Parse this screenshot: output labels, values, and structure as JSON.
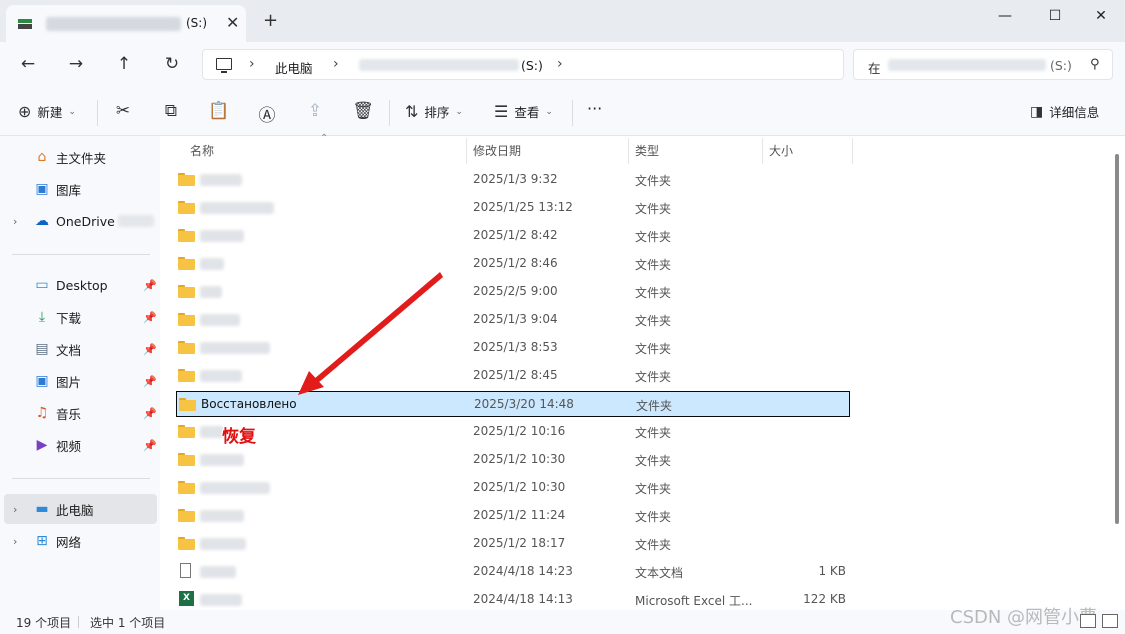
{
  "window": {
    "tab_drive": "(S:)",
    "tab_close": "✕",
    "new_tab": "+",
    "minimize": "—",
    "maximize": "☐",
    "close": "✕"
  },
  "nav": {
    "back": "←",
    "forward": "→",
    "up": "↑",
    "refresh": "↻",
    "breadcrumb_pc": "此电脑",
    "breadcrumb_drive": "(S:)",
    "search_prefix": "在",
    "search_drive": "(S:)",
    "search_icon": "⚲"
  },
  "toolbar": {
    "new_label": "新建",
    "sort_label": "排序",
    "view_label": "查看",
    "more_label": "···",
    "details_label": "详细信息"
  },
  "sidebar": {
    "top_items": [
      {
        "label": "主文件夹",
        "icon": "home-icon"
      },
      {
        "label": "图库",
        "icon": "gallery-icon"
      },
      {
        "label": "OneDrive",
        "icon": "cloud-icon"
      }
    ],
    "pinned_items": [
      {
        "label": "Desktop",
        "icon": "desktop-icon"
      },
      {
        "label": "下载",
        "icon": "download-icon"
      },
      {
        "label": "文档",
        "icon": "document-icon"
      },
      {
        "label": "图片",
        "icon": "pictures-icon"
      },
      {
        "label": "音乐",
        "icon": "music-icon"
      },
      {
        "label": "视频",
        "icon": "video-icon"
      }
    ],
    "bottom_items": [
      {
        "label": "此电脑",
        "icon": "pc-icon"
      },
      {
        "label": "网络",
        "icon": "network-icon"
      }
    ]
  },
  "columns": {
    "name": "名称",
    "date": "修改日期",
    "type": "类型",
    "size": "大小"
  },
  "files": [
    {
      "name": "",
      "date": "2025/1/3 9:32",
      "type": "文件夹",
      "size": "",
      "kind": "folder"
    },
    {
      "name": "",
      "date": "2025/1/25 13:12",
      "type": "文件夹",
      "size": "",
      "kind": "folder"
    },
    {
      "name": "",
      "date": "2025/1/2 8:42",
      "type": "文件夹",
      "size": "",
      "kind": "folder"
    },
    {
      "name": "",
      "date": "2025/1/2 8:46",
      "type": "文件夹",
      "size": "",
      "kind": "folder"
    },
    {
      "name": "",
      "date": "2025/2/5 9:00",
      "type": "文件夹",
      "size": "",
      "kind": "folder"
    },
    {
      "name": "",
      "date": "2025/1/3 9:04",
      "type": "文件夹",
      "size": "",
      "kind": "folder"
    },
    {
      "name": "",
      "date": "2025/1/3 8:53",
      "type": "文件夹",
      "size": "",
      "kind": "folder"
    },
    {
      "name": "",
      "date": "2025/1/2 8:45",
      "type": "文件夹",
      "size": "",
      "kind": "folder"
    },
    {
      "name": "Восстановлено",
      "date": "2025/3/20 14:48",
      "type": "文件夹",
      "size": "",
      "kind": "folder",
      "selected": true
    },
    {
      "name": "",
      "date": "2025/1/2 10:16",
      "type": "文件夹",
      "size": "",
      "kind": "folder"
    },
    {
      "name": "",
      "date": "2025/1/2 10:30",
      "type": "文件夹",
      "size": "",
      "kind": "folder"
    },
    {
      "name": "",
      "date": "2025/1/2 10:30",
      "type": "文件夹",
      "size": "",
      "kind": "folder"
    },
    {
      "name": "",
      "date": "2025/1/2 11:24",
      "type": "文件夹",
      "size": "",
      "kind": "folder"
    },
    {
      "name": "",
      "date": "2025/1/2 18:17",
      "type": "文件夹",
      "size": "",
      "kind": "folder"
    },
    {
      "name": "",
      "date": "2024/4/18 14:23",
      "type": "文本文档",
      "size": "1 KB",
      "kind": "text"
    },
    {
      "name": "",
      "date": "2024/4/18 14:13",
      "type": "Microsoft Excel 工...",
      "size": "122 KB",
      "kind": "excel"
    }
  ],
  "annotation": {
    "label": "恢复",
    "color": "#e01010"
  },
  "status": {
    "item_count": "19 个项目",
    "selected_count": "选中 1 个项目"
  },
  "watermark": "CSDN @网管小曹",
  "colors": {
    "selection": "#cce8ff",
    "folder": "#f6c343",
    "excel": "#1e7145"
  }
}
